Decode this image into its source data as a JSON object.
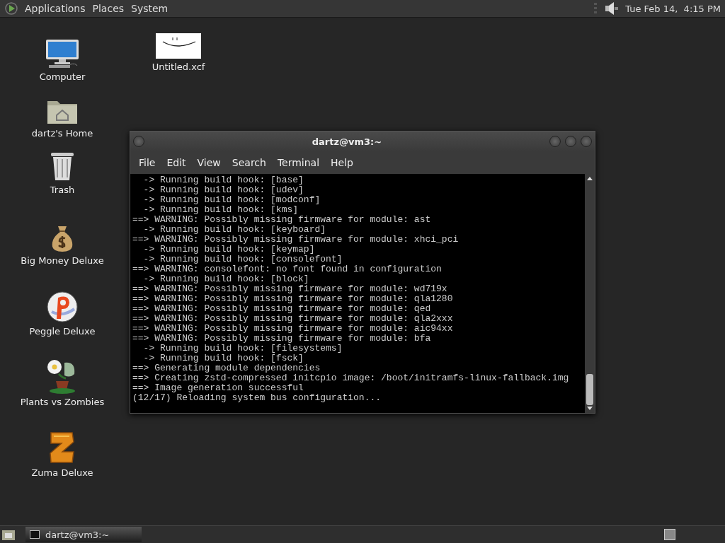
{
  "top_panel": {
    "menus": [
      "Applications",
      "Places",
      "System"
    ],
    "clock": "Tue Feb 14,  4:15 PM"
  },
  "desktop_icons": [
    {
      "label": "Computer",
      "kind": "computer"
    },
    {
      "label": "dartz's Home",
      "kind": "folder"
    },
    {
      "label": "Trash",
      "kind": "trash"
    },
    {
      "label": "Big Money Deluxe",
      "kind": "moneybag"
    },
    {
      "label": "Peggle Deluxe",
      "kind": "peggle"
    },
    {
      "label": "Plants vs Zombies",
      "kind": "plant"
    },
    {
      "label": "Zuma Deluxe",
      "kind": "zuma"
    },
    {
      "label": "Untitled.xcf",
      "kind": "picture"
    }
  ],
  "terminal": {
    "title": "dartz@vm3:~",
    "menus": [
      "File",
      "Edit",
      "View",
      "Search",
      "Terminal",
      "Help"
    ],
    "lines": [
      "  -> Running build hook: [base]",
      "  -> Running build hook: [udev]",
      "  -> Running build hook: [modconf]",
      "  -> Running build hook: [kms]",
      "==> WARNING: Possibly missing firmware for module: ast",
      "  -> Running build hook: [keyboard]",
      "==> WARNING: Possibly missing firmware for module: xhci_pci",
      "  -> Running build hook: [keymap]",
      "  -> Running build hook: [consolefont]",
      "==> WARNING: consolefont: no font found in configuration",
      "  -> Running build hook: [block]",
      "==> WARNING: Possibly missing firmware for module: wd719x",
      "==> WARNING: Possibly missing firmware for module: qla1280",
      "==> WARNING: Possibly missing firmware for module: qed",
      "==> WARNING: Possibly missing firmware for module: qla2xxx",
      "==> WARNING: Possibly missing firmware for module: aic94xx",
      "==> WARNING: Possibly missing firmware for module: bfa",
      "  -> Running build hook: [filesystems]",
      "  -> Running build hook: [fsck]",
      "==> Generating module dependencies",
      "==> Creating zstd-compressed initcpio image: /boot/initramfs-linux-fallback.img",
      "==> Image generation successful",
      "(12/17) Reloading system bus configuration..."
    ]
  },
  "bottom_panel": {
    "tasks": [
      {
        "label": "dartz@vm3:~",
        "selected": true
      }
    ]
  }
}
